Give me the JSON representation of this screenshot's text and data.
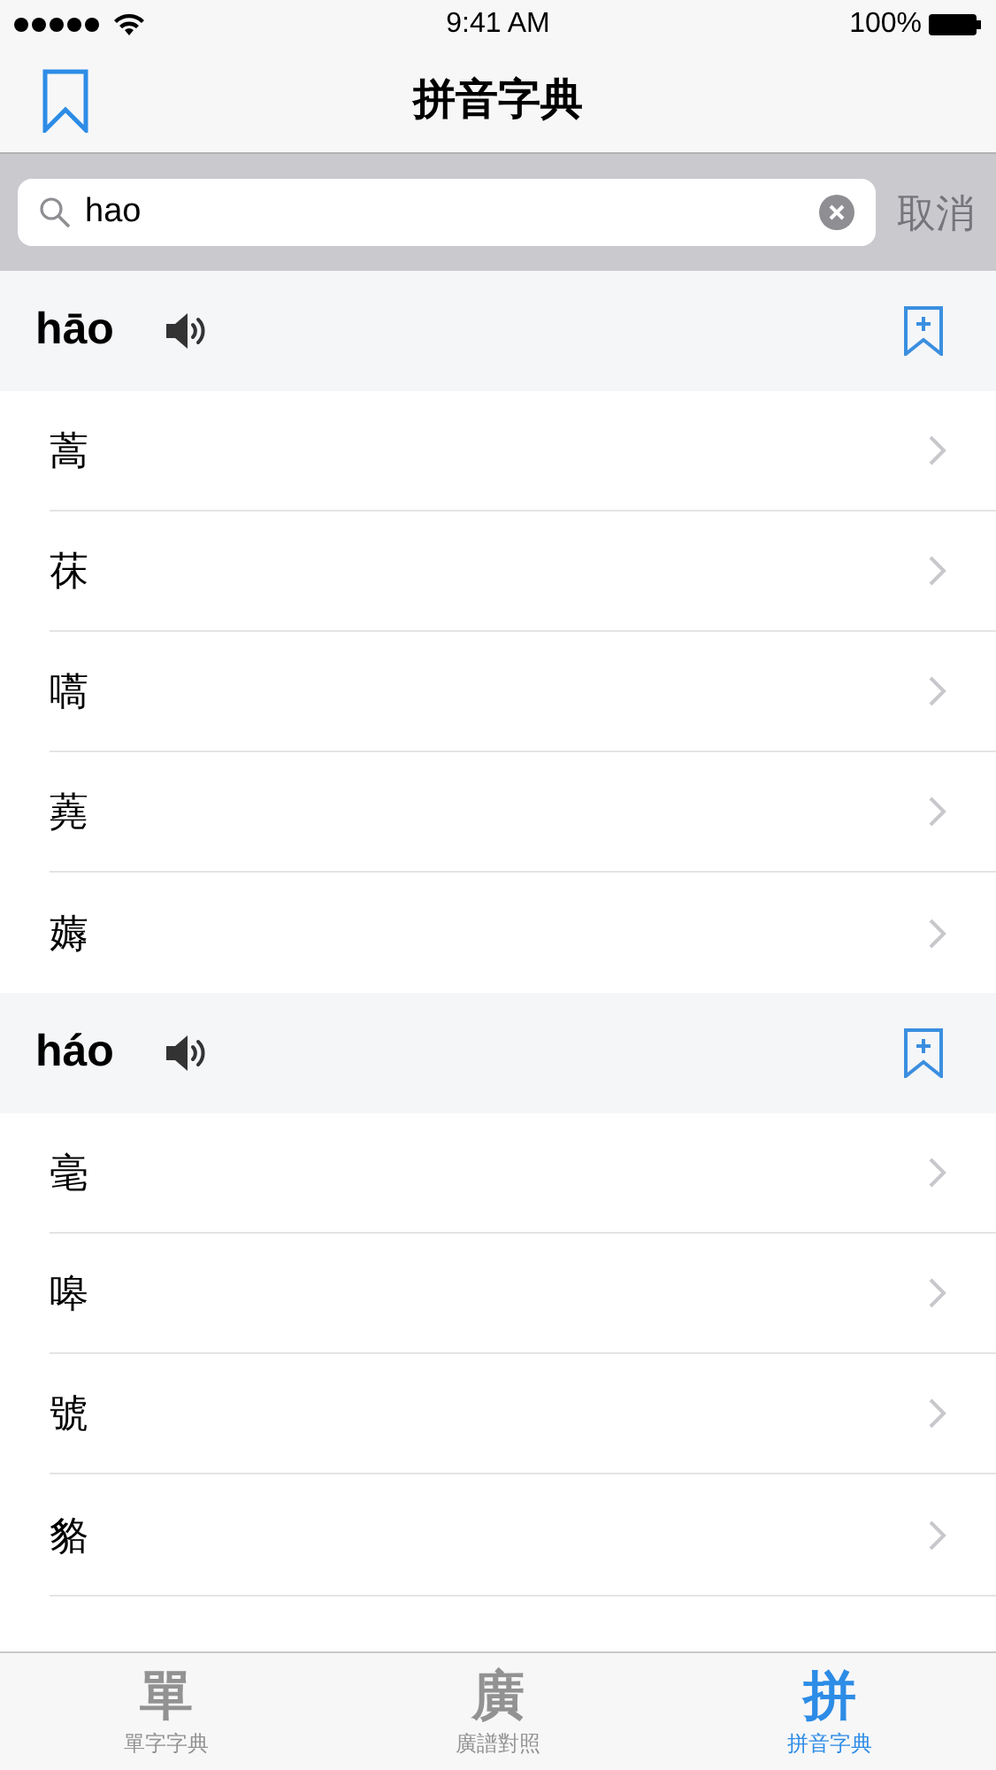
{
  "status_bar": {
    "time": "9:41 AM",
    "battery": "100%"
  },
  "nav": {
    "title": "拼音字典"
  },
  "search": {
    "value": "hao",
    "cancel": "取消"
  },
  "sections": [
    {
      "pinyin": "hāo",
      "characters": [
        "蒿",
        "茠",
        "嚆",
        "蕘",
        "薅"
      ]
    },
    {
      "pinyin": "háo",
      "characters": [
        "毫",
        "嗥",
        "號",
        "貉"
      ]
    }
  ],
  "tabs": [
    {
      "icon": "單",
      "label": "單字字典",
      "selected": false
    },
    {
      "icon": "廣",
      "label": "廣譜對照",
      "selected": false
    },
    {
      "icon": "拼",
      "label": "拼音字典",
      "selected": true
    }
  ]
}
